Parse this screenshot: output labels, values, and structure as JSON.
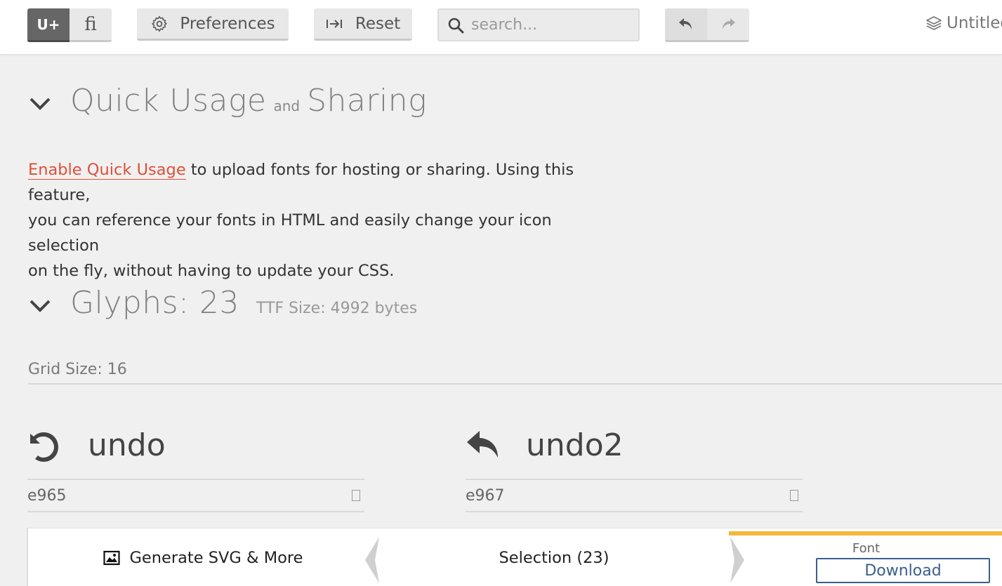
{
  "toolbar": {
    "unicode_toggle": "U+",
    "ligature_toggle": "fi",
    "preferences_label": "Preferences",
    "reset_label": "Reset",
    "search_placeholder": "search...",
    "project_name": "Untitled"
  },
  "quick_usage": {
    "title_part1": "Quick Usage",
    "title_and": "and",
    "title_part2": "Sharing",
    "link_text": "Enable Quick Usage",
    "line1": " to upload fonts for hosting or sharing. Using this feature,",
    "line2": "you can reference your fonts in HTML and easily change your icon selection",
    "line3": "on the fly, without having to update your CSS."
  },
  "glyphs": {
    "title": "Glyphs: 23",
    "ttf_size": "TTF Size: 4992 bytes",
    "grid_size": "Grid Size: 16",
    "items": [
      {
        "name": "undo",
        "code": "e965",
        "icon": "undo-icon"
      },
      {
        "name": "undo2",
        "code": "e967",
        "icon": "undo2-icon"
      }
    ]
  },
  "bottombar": {
    "generate_label": "Generate SVG & More",
    "selection_label": "Selection (23)",
    "font_label": "Font",
    "download_label": "Download"
  },
  "colors": {
    "accent_link": "#e04f38",
    "font_tab_accent": "#f6b63b",
    "download_border": "#3b5f8a"
  }
}
